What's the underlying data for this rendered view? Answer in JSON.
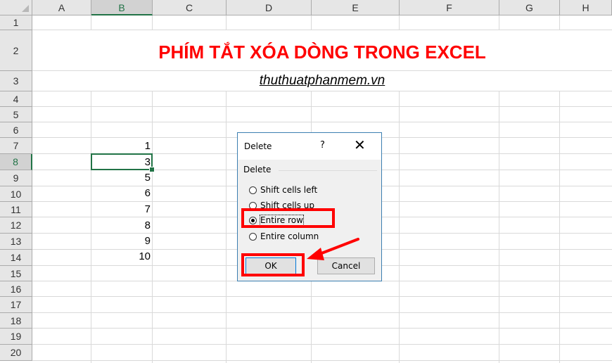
{
  "spreadsheet": {
    "columns": [
      "A",
      "B",
      "C",
      "D",
      "E",
      "F",
      "G",
      "H"
    ],
    "selected_column": "B",
    "rows": [
      "1",
      "2",
      "3",
      "4",
      "5",
      "6",
      "7",
      "8",
      "9",
      "10",
      "11",
      "12",
      "13",
      "14",
      "15",
      "16",
      "17",
      "18",
      "19",
      "20"
    ],
    "selected_row": "8",
    "title": "PHÍM TẮT XÓA DÒNG TRONG EXCEL",
    "subtitle": "thuthuatphanmem.vn",
    "column_b_values": [
      {
        "row": "7",
        "value": "1"
      },
      {
        "row": "8",
        "value": "3"
      },
      {
        "row": "9",
        "value": "5"
      },
      {
        "row": "10",
        "value": "6"
      },
      {
        "row": "11",
        "value": "7"
      },
      {
        "row": "12",
        "value": "8"
      },
      {
        "row": "13",
        "value": "9"
      },
      {
        "row": "14",
        "value": "10"
      }
    ]
  },
  "dialog": {
    "title": "Delete",
    "help": "?",
    "close": "✕",
    "group_label": "Delete",
    "options": [
      {
        "label": "Shift cells left",
        "checked": false
      },
      {
        "label": "Shift cells up",
        "checked": false
      },
      {
        "label": "Entire row",
        "checked": true
      },
      {
        "label": "Entire column",
        "checked": false
      }
    ],
    "ok_label": "OK",
    "cancel_label": "Cancel"
  },
  "colors": {
    "title_red": "#ff0000",
    "excel_green": "#217346",
    "highlight_red": "#ff0000"
  }
}
